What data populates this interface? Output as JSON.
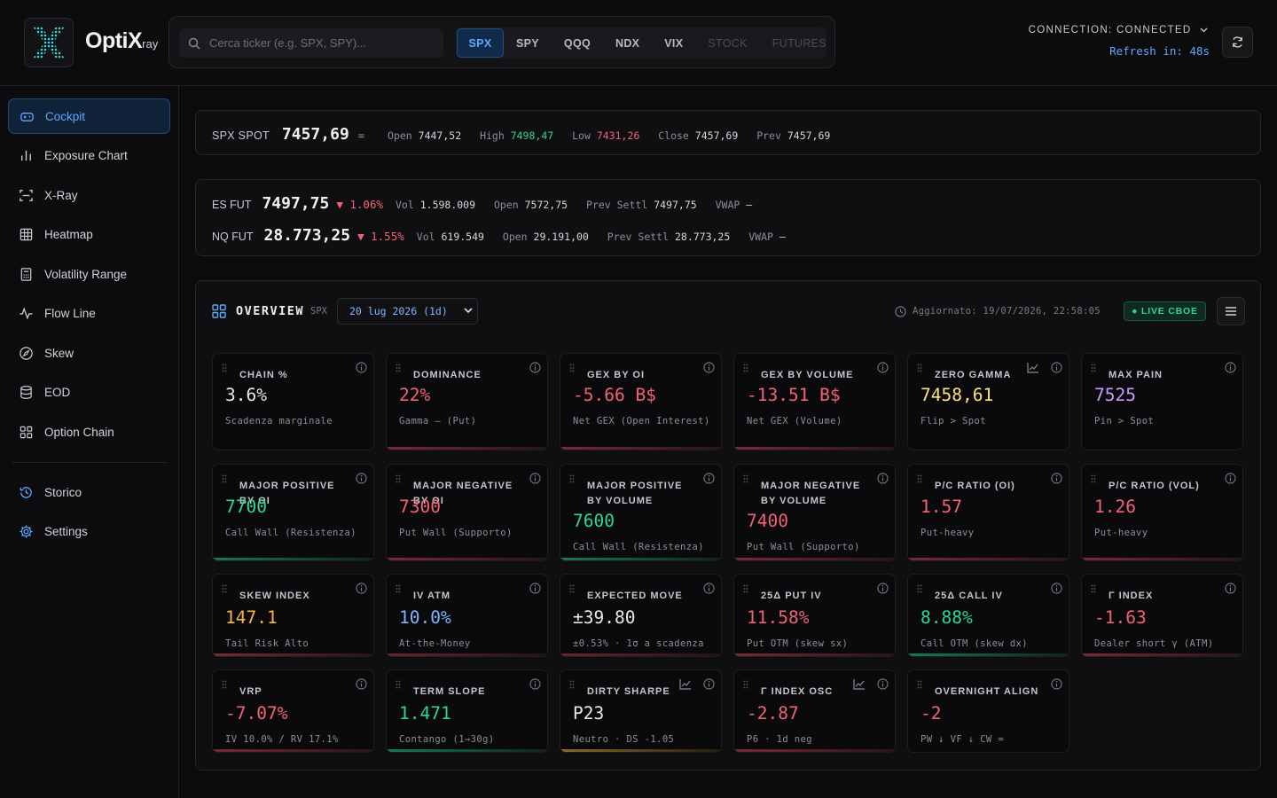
{
  "app": {
    "brand": "OptiX",
    "brand_suffix": "ray"
  },
  "search": {
    "placeholder": "Cerca ticker (e.g. SPX, SPY)..."
  },
  "tickers": [
    "SPX",
    "SPY",
    "QQQ",
    "NDX",
    "VIX",
    "STOCK",
    "FUTURES"
  ],
  "connection": {
    "label": "CONNECTION: CONNECTED",
    "refresh": "Refresh in: 48s"
  },
  "sidebar": {
    "items": [
      "Cockpit",
      "Exposure Chart",
      "X-Ray",
      "Heatmap",
      "Volatility Range",
      "Flow Line",
      "Skew",
      "EOD",
      "Option Chain"
    ],
    "bottom": [
      "Storico",
      "Settings"
    ]
  },
  "spot": {
    "label": "SPX SPOT",
    "value": "7457,69",
    "mark": "=",
    "open_l": "Open",
    "open": "7447,52",
    "high_l": "High",
    "high": "7498,47",
    "low_l": "Low",
    "low": "7431,26",
    "close_l": "Close",
    "close": "7457,69",
    "prev_l": "Prev",
    "prev": "7457,69"
  },
  "futures": [
    {
      "label": "ES FUT",
      "value": "7497,75",
      "chg": "▼ 1.06%",
      "vol_l": "Vol",
      "vol": "1.598.009",
      "open_l": "Open",
      "open": "7572,75",
      "prev_l": "Prev Settl",
      "prev": "7497,75",
      "vwap_l": "VWAP",
      "vwap": "—"
    },
    {
      "label": "NQ FUT",
      "value": "28.773,25",
      "chg": "▼ 1.55%",
      "vol_l": "Vol",
      "vol": "619.549",
      "open_l": "Open",
      "open": "29.191,00",
      "prev_l": "Prev Settl",
      "prev": "28.773,25",
      "vwap_l": "VWAP",
      "vwap": "—"
    }
  ],
  "overview": {
    "title": "OVERVIEW",
    "ticker": "SPX",
    "expiry": "20 lug 2026 (1d)",
    "updated": "Aggiornato: 19/07/2026, 22:58:05",
    "live": "● LIVE CBOE"
  },
  "cards": [
    {
      "title": "CHAIN %",
      "value": "3.6%",
      "sub": "Scadenza marginale",
      "color": "white"
    },
    {
      "title": "DOMINANCE",
      "value": "22%",
      "sub": "Gamma — (Put)",
      "color": "red"
    },
    {
      "title": "GEX BY OI",
      "value": "-5.66 B$",
      "sub": "Net GEX (Open Interest)",
      "color": "red"
    },
    {
      "title": "GEX BY VOLUME",
      "value": "-13.51 B$",
      "sub": "Net GEX (Volume)",
      "color": "red"
    },
    {
      "title": "ZERO GAMMA",
      "value": "7458,61",
      "sub": "Flip > Spot",
      "color": "yellow"
    },
    {
      "title": "MAX PAIN",
      "value": "7525",
      "sub": "Pin > Spot",
      "color": "purple"
    },
    {
      "title": "MAJOR POSITIVE BY OI",
      "value": "7700",
      "sub": "Call Wall (Resistenza)",
      "color": "green"
    },
    {
      "title": "MAJOR NEGATIVE BY OI",
      "value": "7300",
      "sub": "Put Wall (Supporto)",
      "color": "red"
    },
    {
      "title": "MAJOR POSITIVE BY VOLUME",
      "value": "7600",
      "sub": "Call Wall (Resistenza)",
      "color": "green"
    },
    {
      "title": "MAJOR NEGATIVE BY VOLUME",
      "value": "7400",
      "sub": "Put Wall (Supporto)",
      "color": "red"
    },
    {
      "title": "P/C RATIO (OI)",
      "value": "1.57",
      "sub": "Put-heavy",
      "color": "red"
    },
    {
      "title": "P/C RATIO (VOL)",
      "value": "1.26",
      "sub": "Put-heavy",
      "color": "red"
    },
    {
      "title": "SKEW INDEX",
      "value": "147.1",
      "sub": "Tail Risk Alto",
      "color": "orange"
    },
    {
      "title": "IV ATM",
      "value": "10.0%",
      "sub": "At-the-Money",
      "color": "blue"
    },
    {
      "title": "EXPECTED MOVE",
      "value": "±39.80",
      "sub": "±0.53% · 1σ a scadenza",
      "color": "white"
    },
    {
      "title": "25Δ PUT IV",
      "value": "11.58%",
      "sub": "Put OTM (skew sx)",
      "color": "red"
    },
    {
      "title": "25Δ CALL IV",
      "value": "8.88%",
      "sub": "Call OTM (skew dx)",
      "color": "green"
    },
    {
      "title": "Γ INDEX",
      "value": "-1.63",
      "sub": "Dealer short γ (ATM)",
      "color": "red"
    },
    {
      "title": "VRP",
      "value": "-7.07%",
      "sub": "IV 10.0% / RV 17.1%",
      "color": "red"
    },
    {
      "title": "TERM SLOPE",
      "value": "1.471",
      "sub": "Contango (1→30g)",
      "color": "green"
    },
    {
      "title": "DIRTY SHARPE",
      "value": "P23",
      "sub": "Neutro · DS -1.05",
      "color": "white"
    },
    {
      "title": "Γ INDEX OSC",
      "value": "-2.87",
      "sub": "P6 · 1d neg",
      "color": "red"
    },
    {
      "title": "OVERNIGHT ALIGN",
      "value": "-2",
      "sub": "PW ↓ VF ↓ CW =",
      "color": "red"
    }
  ]
}
